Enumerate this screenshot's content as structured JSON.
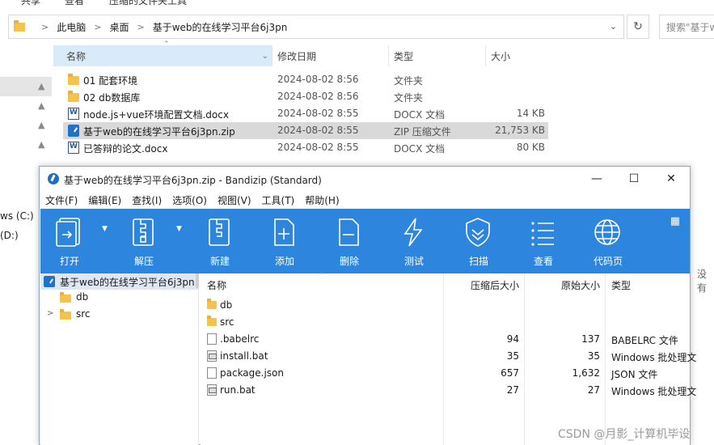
{
  "explorer": {
    "ribbon_tabs": [
      "共享",
      "查看",
      "压缩的文件夹工具"
    ],
    "breadcrumbs": [
      "此电脑",
      "桌面",
      "基于web的在线学习平台6j3pn"
    ],
    "search_placeholder": "搜索\"基于w",
    "nav_drives": [
      "ws (C:)",
      "(D:)"
    ],
    "columns": {
      "name": "名称",
      "date": "修改日期",
      "type": "类型",
      "size": "大小"
    },
    "files": [
      {
        "name": "01  配套环境",
        "date": "2024-08-02 8:56",
        "type": "文件夹",
        "size": "",
        "icon": "folder-icon"
      },
      {
        "name": "02 db数据库",
        "date": "2024-08-02 8:56",
        "type": "文件夹",
        "size": "",
        "icon": "folder-icon"
      },
      {
        "name": "node.js+vue环境配置文档.docx",
        "date": "2024-08-02 8:55",
        "type": "DOCX 文档",
        "size": "14 KB",
        "icon": "docx-icon"
      },
      {
        "name": "基于web的在线学习平台6j3pn.zip",
        "date": "2024-08-02 8:55",
        "type": "ZIP 压缩文件",
        "size": "21,753 KB",
        "icon": "zip-icon"
      },
      {
        "name": "已答辩的论文.docx",
        "date": "2024-08-02 8:55",
        "type": "DOCX 文档",
        "size": "80 KB",
        "icon": "docx-icon"
      }
    ],
    "side_note": "没有"
  },
  "bandizip": {
    "title": "基于web的在线学习平台6j3pn.zip - Bandizip (Standard)",
    "menu": [
      "文件(F)",
      "编辑(E)",
      "查找(I)",
      "选项(O)",
      "视图(V)",
      "工具(T)",
      "帮助(H)"
    ],
    "toolbar": [
      "打开",
      "解压",
      "新建",
      "添加",
      "删除",
      "测试",
      "扫描",
      "查看",
      "代码页"
    ],
    "tree": [
      {
        "label": "基于web的在线学习平台6j3pn.zip"
      },
      {
        "label": "db"
      },
      {
        "label": "src"
      }
    ],
    "list_columns": {
      "name": "名称",
      "compressed": "压缩后大小",
      "original": "原始大小",
      "type": "类型"
    },
    "items": [
      {
        "name": "db",
        "compressed": "",
        "original": "",
        "type": "",
        "icon": "folder-icon"
      },
      {
        "name": "src",
        "compressed": "",
        "original": "",
        "type": "",
        "icon": "folder-icon"
      },
      {
        "name": ".babelrc",
        "compressed": "94",
        "original": "137",
        "type": "BABELRC 文件",
        "icon": "file-icon"
      },
      {
        "name": "install.bat",
        "compressed": "35",
        "original": "35",
        "type": "Windows 批处理文",
        "icon": "bat-icon"
      },
      {
        "name": "package.json",
        "compressed": "657",
        "original": "1,632",
        "type": "JSON 文件",
        "icon": "file-icon"
      },
      {
        "name": "run.bat",
        "compressed": "27",
        "original": "27",
        "type": "Windows 批处理文",
        "icon": "bat-icon"
      }
    ]
  },
  "watermark": "CSDN @月影_计算机毕设"
}
